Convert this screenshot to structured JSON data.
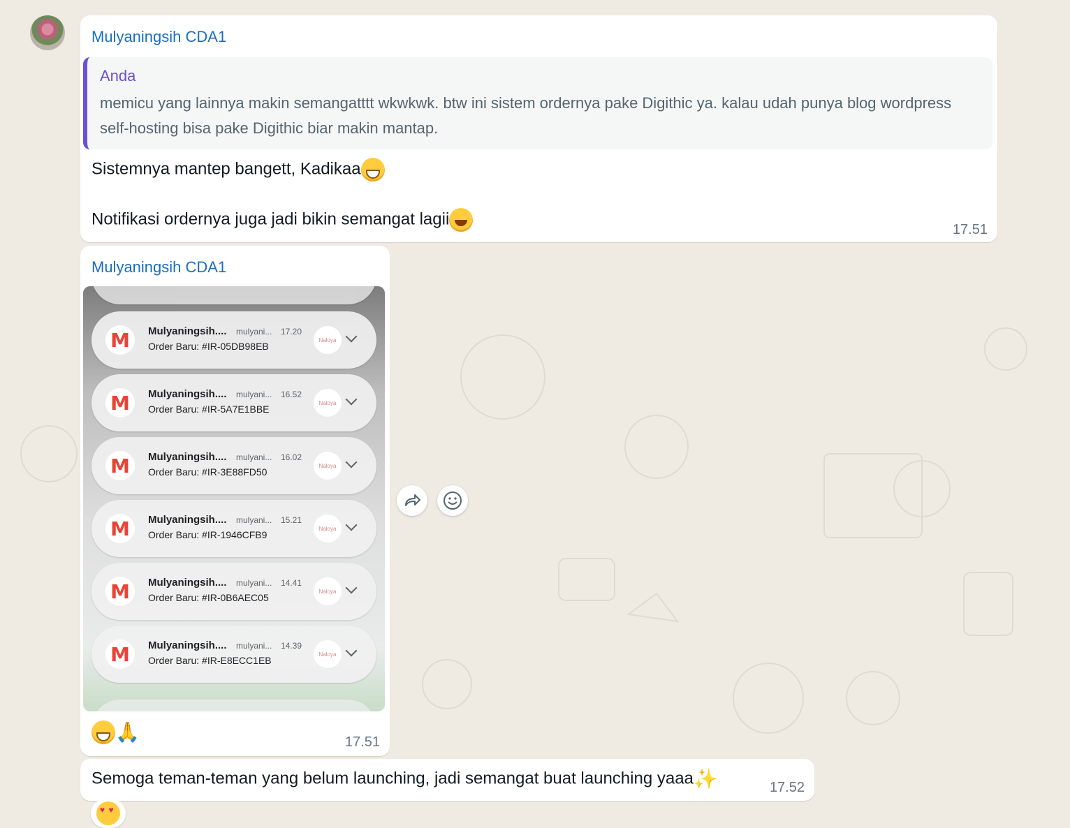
{
  "messages": {
    "m1": {
      "sender": "Mulyaningsih CDA1",
      "quote_author": "Anda",
      "quote_text": "memicu yang lainnya makin semangatttt wkwkwk. btw ini sistem ordernya pake Digithic ya. kalau udah punya blog wordpress self-hosting bisa pake Digithic biar makin mantap.",
      "line1": "Sistemnya mantep bangett, Kadikaa",
      "line2": "Notifikasi ordernya juga jadi bikin semangat lagii",
      "time": "17.51"
    },
    "m2": {
      "sender": "Mulyaningsih CDA1",
      "time": "17.51",
      "notifications": [
        {
          "title": "Mulyaningsih....",
          "account": "mulyani...",
          "time": "17.20",
          "body": "Order Baru: #IR-05DB98EB",
          "brand": "Naloya"
        },
        {
          "title": "Mulyaningsih....",
          "account": "mulyani...",
          "time": "16.52",
          "body": "Order Baru: #IR-5A7E1BBE",
          "brand": "Naloya"
        },
        {
          "title": "Mulyaningsih....",
          "account": "mulyani...",
          "time": "16.02",
          "body": "Order Baru: #IR-3E88FD50",
          "brand": "Naloya"
        },
        {
          "title": "Mulyaningsih....",
          "account": "mulyani...",
          "time": "15.21",
          "body": "Order Baru: #IR-1946CFB9",
          "brand": "Naloya"
        },
        {
          "title": "Mulyaningsih....",
          "account": "mulyani...",
          "time": "14.41",
          "body": "Order Baru: #IR-0B6AEC05",
          "brand": "Naloya"
        },
        {
          "title": "Mulyaningsih....",
          "account": "mulyani...",
          "time": "14.39",
          "body": "Order Baru: #IR-E8ECC1EB",
          "brand": "Naloya"
        }
      ]
    },
    "m3": {
      "text": "Semoga teman-teman yang belum launching, jadi semangat buat launching yaaa",
      "time": "17.52"
    }
  },
  "icons": {
    "forward": "forward-icon",
    "emoji": "emoji-icon",
    "gmail": "gmail-icon"
  }
}
